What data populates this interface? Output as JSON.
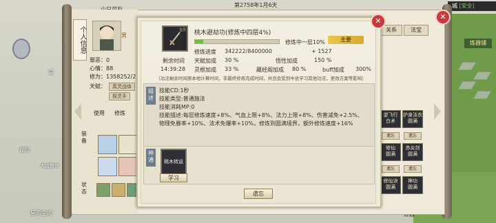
{
  "top": {
    "date_text": "第2758年1月6天",
    "location_fragment": "城",
    "safe_label": "[安全]",
    "craft_label": "炼器铺",
    "left_top_label": "山只可石"
  },
  "character_panel": {
    "title": "个人信息",
    "gender": "男",
    "rows": [
      {
        "label": "罪恶：",
        "value": "0"
      },
      {
        "label": "心情：",
        "value": "88"
      },
      {
        "label": "修为：",
        "value": "1358252/2"
      }
    ],
    "talent_label": "天赋：",
    "talent_chips": [
      "真灵战体",
      "探灵手"
    ],
    "equip_label": "装备",
    "state_label": "状态",
    "use_label": "使用",
    "cultivate_label": "修炼",
    "tab_labels": [
      "关系",
      "法宝"
    ]
  },
  "skill": {
    "name": "桃木避劫功(修炼中四层4%)",
    "icon_text": "宝丹",
    "status_text": "修炼中一层10%",
    "main_badge": "主要",
    "progress_fraction": 0.1,
    "stats": [
      {
        "label": "修炼进度",
        "value": "342222/8400000",
        "extra": "+ 1527"
      },
      {
        "label": "剩余时间",
        "value": "",
        "label2": "天赋加成",
        "value2": "30 %",
        "label3": "悟性加成",
        "value3": "150 %"
      },
      {
        "label": "14:39:28",
        "value": "",
        "label2": "灵根加成",
        "value2": "33 %",
        "label3": "藏经阁加成",
        "value3": "80 %",
        "label4": "buff加成",
        "value4": "300%"
      }
    ],
    "note": "（功法剩余时间按本地计算时间，非最终修炼完成时间，并且会受到中途学习其他功法，更改方案等影响）",
    "desc_tab": "描述",
    "desc_lines": [
      "技能CD:1秒",
      "技能类型:普通施法",
      "技能消耗MP:0",
      "技能描述:每层修炼速度+8%、气血上限+8%、法力上限+8%、伤害减免+2.5%、物理免暴率+10%、法术免爆率+10%，修炼到圆满境界，额外修炼速度+16%"
    ],
    "passive_tab": "神通",
    "passive_skill": "桃木转运",
    "learn_button": "学习",
    "forget_button": "遗忘"
  },
  "right_panel": {
    "slots": [
      {
        "label": "逆飞行\n白术"
      },
      {
        "label": "护身法衣\n圆满"
      },
      {
        "label": "修仙\n圆满"
      },
      {
        "label": "赤炎剑\n圆满"
      },
      {
        "label": "修仙诀\n圆满"
      },
      {
        "label": "神功\n圆满"
      }
    ],
    "small_buttons": [
      "遗忘",
      "遗忘",
      "遗忘",
      "遗忘"
    ]
  },
  "world_tags": {
    "left_label1": "哥",
    "left_label2": "抛位",
    "left_label3": "大道散修",
    "bottom_label": "星雨尘的",
    "bottom_right_label": "炼器"
  }
}
